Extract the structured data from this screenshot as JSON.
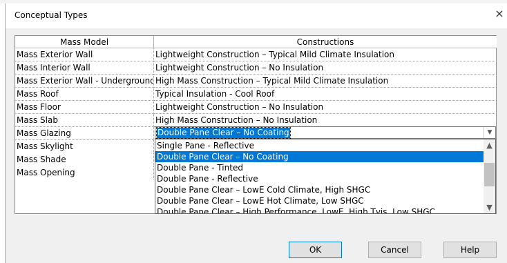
{
  "window": {
    "title": "Conceptual Types",
    "close_glyph": "×"
  },
  "table": {
    "headers": [
      "Mass Model",
      "Constructions"
    ],
    "rows": [
      {
        "model": "Mass Exterior Wall",
        "construction": "Lightweight Construction – Typical Mild Climate Insulation"
      },
      {
        "model": "Mass Interior Wall",
        "construction": "Lightweight Construction – No Insulation"
      },
      {
        "model": "Mass Exterior Wall - Underground",
        "construction": "High Mass Construction – Typical Mild Climate Insulation"
      },
      {
        "model": "Mass Roof",
        "construction": "Typical Insulation - Cool Roof"
      },
      {
        "model": "Mass Floor",
        "construction": "Lightweight Construction – No Insulation"
      },
      {
        "model": "Mass Slab",
        "construction": "High Mass Construction – No Insulation"
      },
      {
        "model": "Mass Glazing",
        "construction": "Double Pane Clear – No Coating"
      },
      {
        "model": "Mass Skylight",
        "construction": ""
      },
      {
        "model": "Mass Shade",
        "construction": ""
      },
      {
        "model": "Mass Opening",
        "construction": ""
      }
    ]
  },
  "combo": {
    "value": "Double Pane Clear – No Coating",
    "options": [
      "Single Pane - Reflective",
      "Double Pane Clear – No Coating",
      "Double Pane - Tinted",
      "Double Pane - Reflective",
      "Double Pane Clear – LowE Cold Climate, High SHGC",
      "Double Pane Clear – LowE Hot Climate, Low SHGC",
      "Double Pane Clear – High Performance, LowE, High Tvis, Low SHGC"
    ],
    "selected_index": 1
  },
  "buttons": {
    "ok": "OK",
    "cancel": "Cancel",
    "help": "Help"
  },
  "icons": {
    "close": "close-icon",
    "dropdown": "chevron-down-icon",
    "scroll_up": "chevron-up-icon",
    "scroll_down": "chevron-down-icon"
  },
  "colors": {
    "selection": "#0078d7",
    "dialog_bg": "#f0f0f0"
  }
}
